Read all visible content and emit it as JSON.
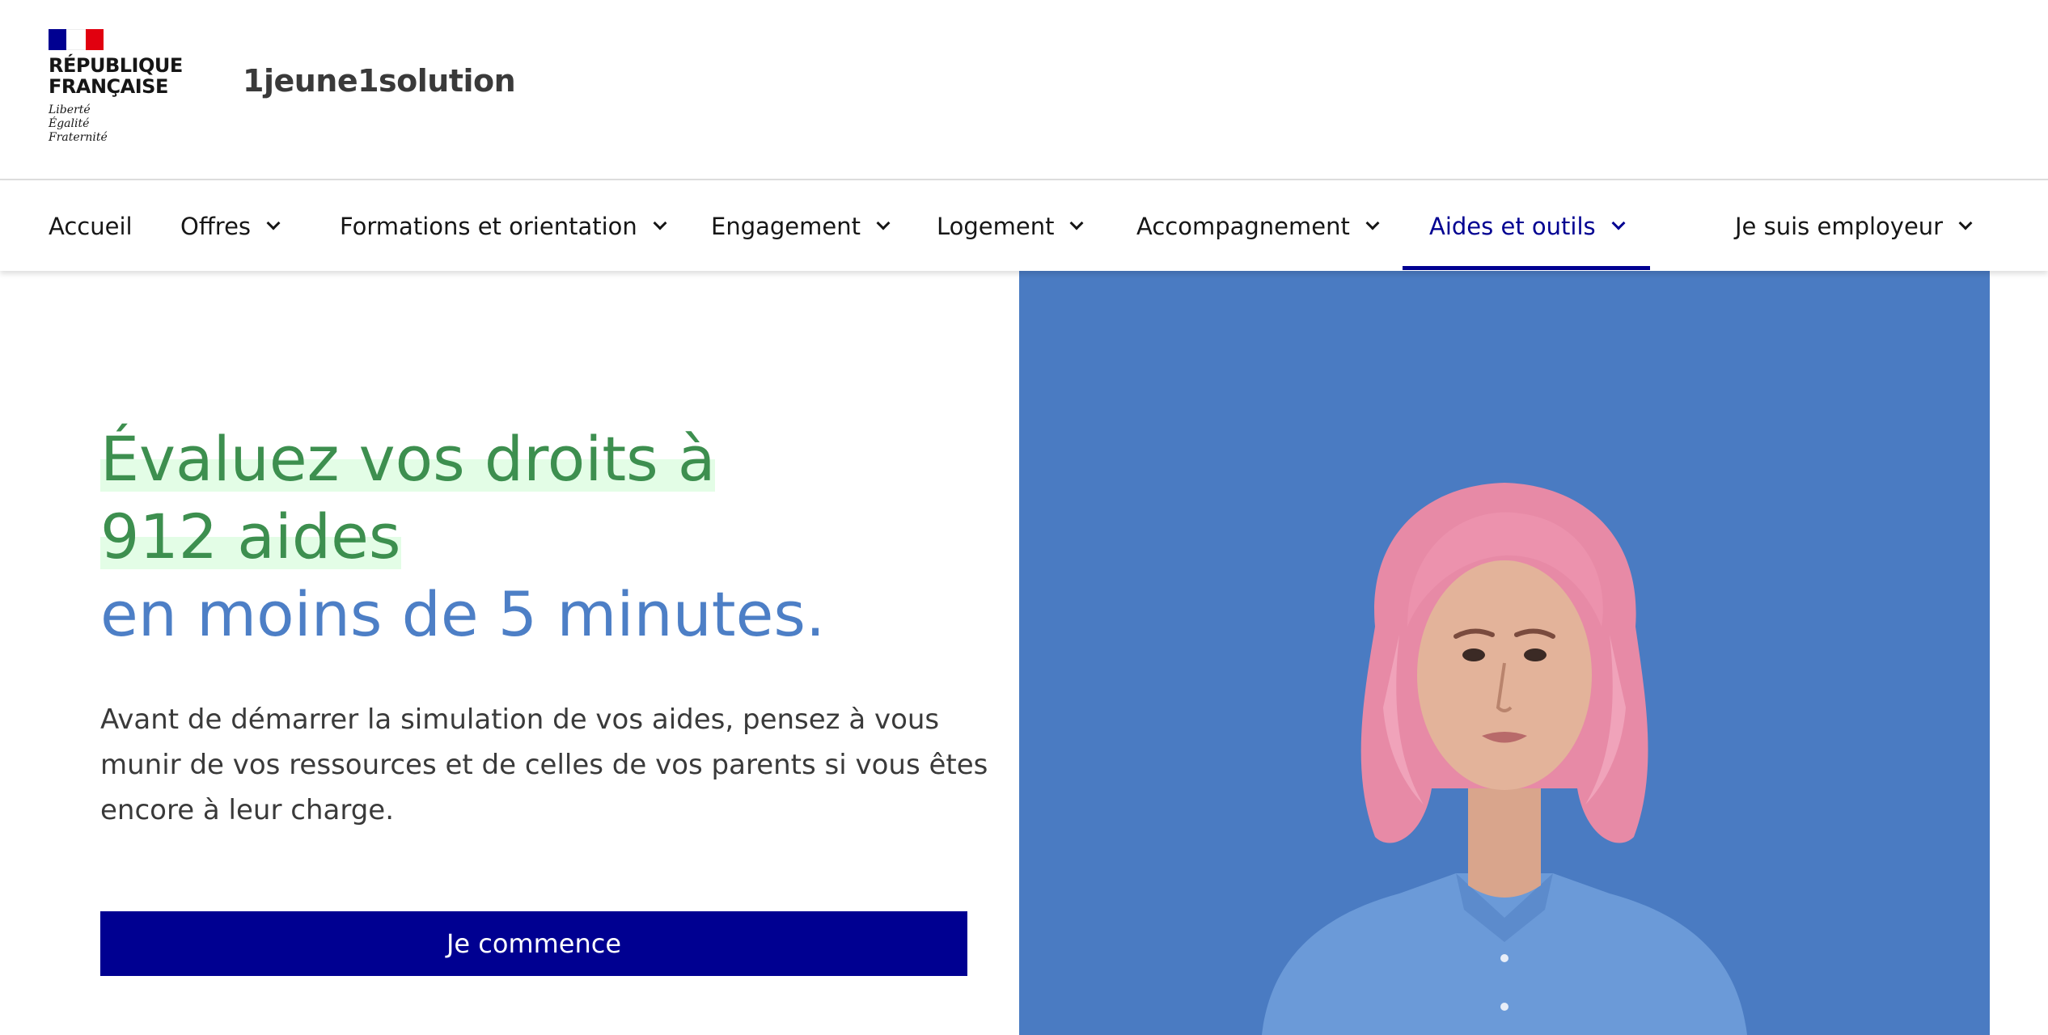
{
  "header": {
    "republic_line1": "RÉPUBLIQUE",
    "republic_line2": "FRANÇAISE",
    "motto": [
      "Liberté",
      "Égalité",
      "Fraternité"
    ],
    "site_name": "1jeune1solution"
  },
  "nav": {
    "items": [
      {
        "label": "Accueil"
      },
      {
        "label": "Offres"
      },
      {
        "label": "Formations et orientation"
      },
      {
        "label": "Engagement"
      },
      {
        "label": "Logement"
      },
      {
        "label": "Accompagnement"
      },
      {
        "label": "Aides et outils"
      },
      {
        "label": "Je suis employeur"
      }
    ],
    "active_item": "Aides et outils"
  },
  "hero": {
    "title_line1": "Évaluez vos droits à",
    "title_line2": "912 aides",
    "title_line3": "en moins de 5 minutes.",
    "description": "Avant de démarrer la simulation de vos aides, pensez à vous munir de vos ressources et de celles de vos parents si vous êtes encore à leur charge.",
    "cta_label": "Je commence"
  },
  "colors": {
    "brand_blue": "#000091",
    "marianne_red": "#e1000f",
    "title_green": "#3d8f4f",
    "highlight_green": "#e3fde6",
    "title_blue": "#4d7fc6",
    "image_background": "#4a7bc2",
    "hair_pink": "#e78aa6",
    "shirt_blue": "#6b9ad8"
  }
}
